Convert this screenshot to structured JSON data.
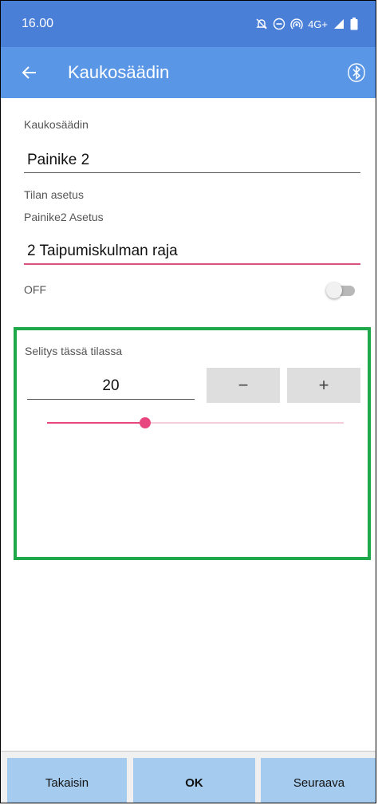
{
  "status_bar": {
    "time": "16.00",
    "network": "4G+"
  },
  "app_bar": {
    "title": "Kaukosäädin",
    "back_icon": "arrow-left-icon",
    "bluetooth_icon": "bluetooth-icon"
  },
  "form": {
    "remote_label": "Kaukosäädin",
    "remote_value": "Painike 2",
    "state_setting_label": "Tilan asetus",
    "button_setting_label": "Painike2 Asetus",
    "setting_value": "2 Taipumiskulman raja",
    "toggle_label": "OFF",
    "toggle_on": false
  },
  "panel": {
    "description": "Selitys tässä tilassa",
    "value": "20",
    "minus_label": "−",
    "plus_label": "+",
    "slider_fraction": 0.33
  },
  "bottom_buttons": {
    "back": "Takaisin",
    "ok": "OK",
    "next": "Seuraava"
  },
  "colors": {
    "status_bar": "#4a7fd8",
    "app_bar": "#5a96e6",
    "accent": "#e8467e",
    "panel_border": "#1ea84a",
    "bottom_button": "#a5ccef"
  }
}
